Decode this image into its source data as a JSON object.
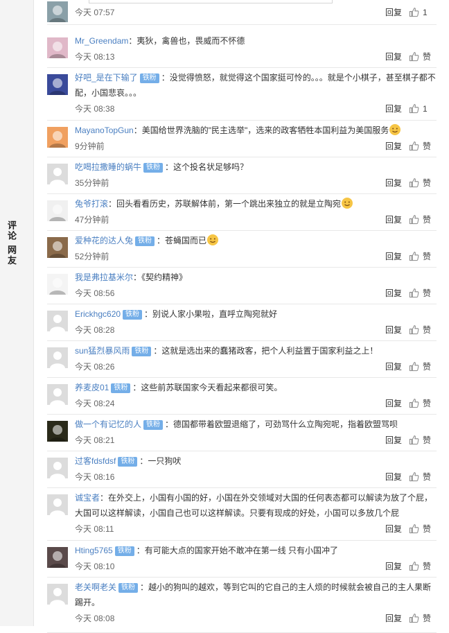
{
  "sidebar": {
    "label": "评论 网友"
  },
  "actions": {
    "reply": "回复",
    "like": "赞"
  },
  "comments": [
    {
      "user": "",
      "badge": "",
      "text": "",
      "time": "今天 07:57",
      "likes": "1",
      "avatar_color": "#8aa0a8"
    },
    {
      "user": "Mr_Greendam",
      "badge": "",
      "text": "：夷狄，禽兽也，畏威而不怀德",
      "time": "今天 08:13",
      "likes": "",
      "avatar_color": "#e0b8c8"
    },
    {
      "user": "好吧_是在下输了",
      "badge": "铁粉",
      "text": "：没觉得愤怒，就觉得这个国家挺可怜的。。。就是个小棋子，甚至棋子都不配，小国悲哀。。。",
      "time": "今天 08:38",
      "likes": "1",
      "avatar_color": "#3a4a9a"
    },
    {
      "user": "MayanoTopGun",
      "badge": "",
      "text": "：美国给世界洗脑的\"民主选举\"，选来的政客牺牲本国利益为美国服务",
      "time": "9分钟前",
      "likes": "",
      "avatar_color": "#f0a060"
    },
    {
      "user": "吃喝拉撒睡的蜗牛",
      "badge": "铁粉",
      "text": "：这个投名状足够吗？",
      "time": "35分钟前",
      "likes": "",
      "avatar_color": "#dcdcdc"
    },
    {
      "user": "兔爷打滚",
      "badge": "",
      "text": "：回头看看历史，苏联解体前，第一个跳出来独立的就是立陶宛",
      "time": "47分钟前",
      "likes": "",
      "avatar_color": "#f0f0f0"
    },
    {
      "user": "爱种花的达人兔",
      "badge": "铁粉",
      "text": "：苍蝇国而已",
      "time": "52分钟前",
      "likes": "",
      "avatar_color": "#8a6a4a"
    },
    {
      "user": "我是弗拉基米尔",
      "badge": "",
      "text": "：《契约精神》",
      "time": "今天 08:56",
      "likes": "",
      "avatar_color": "#f4f4f4"
    },
    {
      "user": "Erickhgc620",
      "badge": "铁粉",
      "text": "：别说人家小果啦，直呼立陶宛就好",
      "time": "今天 08:28",
      "likes": "",
      "avatar_color": "#dcdcdc"
    },
    {
      "user": "sun猛烈暴风雨",
      "badge": "铁粉",
      "text": "：这就是选出来的蠢猪政客，把个人利益置于国家利益之上！",
      "time": "今天 08:26",
      "likes": "",
      "avatar_color": "#dcdcdc"
    },
    {
      "user": "养麦皮01",
      "badge": "铁粉",
      "text": "：这些前苏联国家今天看起来都很可笑。",
      "time": "今天 08:24",
      "likes": "",
      "avatar_color": "#dcdcdc"
    },
    {
      "user": "做一个有记忆的人",
      "badge": "铁粉",
      "text": "：德国都带着欧盟退缩了，可劲骂什么立陶宛呢，指着欧盟骂呗",
      "time": "今天 08:21",
      "likes": "",
      "avatar_color": "#2a2a1a"
    },
    {
      "user": "过客fdsfdsf",
      "badge": "铁粉",
      "text": "：一只狗吠",
      "time": "今天 08:16",
      "likes": "",
      "avatar_color": "#dcdcdc"
    },
    {
      "user": "诚宝者",
      "badge": "",
      "text": "：在外交上，小国有小国的好，小国在外交领域对大国的任何表态都可以解读为放了个屁，大国可以这样解读，小国自己也可以这样解读。只要有现成的好处，小国可以多放几个屁",
      "time": "今天 08:11",
      "likes": "",
      "avatar_color": "#dcdcdc"
    },
    {
      "user": "Hting5765",
      "badge": "铁粉",
      "text": "：有可能大点的国家开始不敢冲在第一线 只有小国冲了",
      "time": "今天 08:10",
      "likes": "",
      "avatar_color": "#5a4a4a"
    },
    {
      "user": "老关啊老关",
      "badge": "铁粉",
      "text": "：越小的狗叫的越欢，等到它叫的它自己的主人烦的时候就会被自己的主人果断踢开。",
      "time": "今天 08:08",
      "likes": "",
      "avatar_color": "#dcdcdc"
    }
  ]
}
